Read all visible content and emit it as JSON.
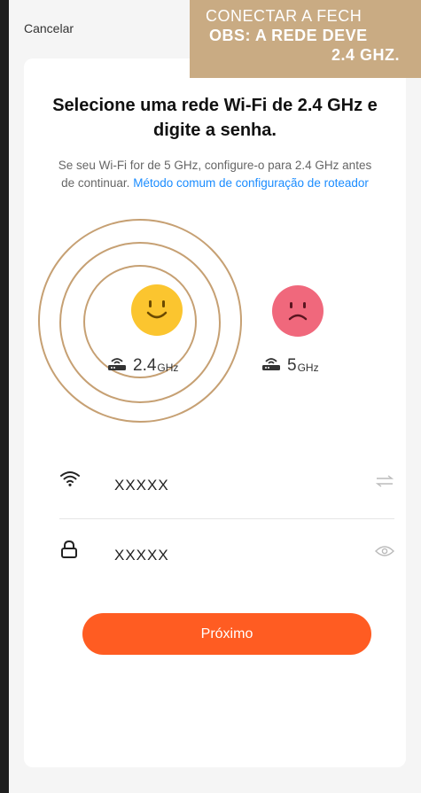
{
  "header": {
    "cancel_label": "Cancelar"
  },
  "overlay": {
    "line1": "CONECTAR A FECH",
    "line2": "OBS: A REDE DEVE",
    "line3": "2.4 GHZ."
  },
  "main": {
    "title": "Selecione uma rede Wi-Fi de 2.4 GHz e digite a senha.",
    "subtitle": "Se seu Wi-Fi for de 5 GHz, configure-o para 2.4 GHz antes de continuar.",
    "link": "Método comum de configuração de roteador",
    "band_24": {
      "value": "2.4",
      "unit": "GHz"
    },
    "band_5": {
      "value": "5",
      "unit": "GHz"
    }
  },
  "form": {
    "ssid_value": "XXXXX",
    "password_value": "XXXXX"
  },
  "actions": {
    "next_label": "Próximo"
  },
  "colors": {
    "accent": "#ff5c22",
    "link": "#1a8cff",
    "happy": "#fbc52f",
    "sad": "#f0687c",
    "overlay": "#c9ab83"
  }
}
